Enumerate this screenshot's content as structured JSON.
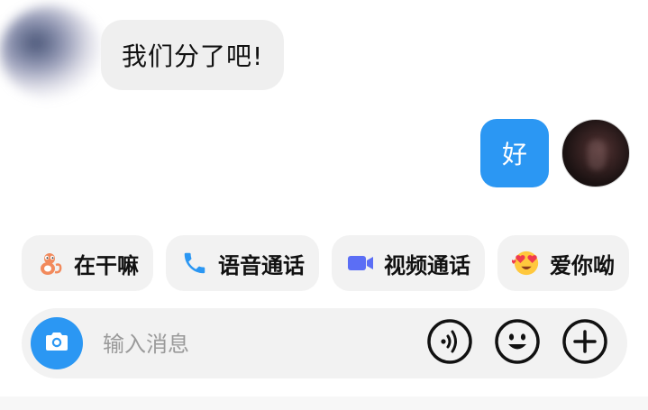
{
  "chat": {
    "incoming_message": "我们分了吧!",
    "outgoing_message": "好"
  },
  "quick_replies": [
    {
      "label": "在干嘛",
      "icon": "cartoon-character-icon"
    },
    {
      "label": "语音通话",
      "icon": "phone-icon"
    },
    {
      "label": "视频通话",
      "icon": "video-camera-icon"
    },
    {
      "label": "爱你呦",
      "icon": "heart-eyes-emoji-icon"
    }
  ],
  "composer": {
    "placeholder": "输入消息",
    "camera_icon": "camera-icon",
    "voice_icon": "voice-icon",
    "emoji_icon": "smiley-icon",
    "more_icon": "plus-icon"
  },
  "colors": {
    "accent": "#2b97f3",
    "incoming_bubble": "#efefef",
    "chip_background": "#f2f2f2",
    "phone_icon": "#2b97f3",
    "video_icon": "#5b6ef5"
  }
}
